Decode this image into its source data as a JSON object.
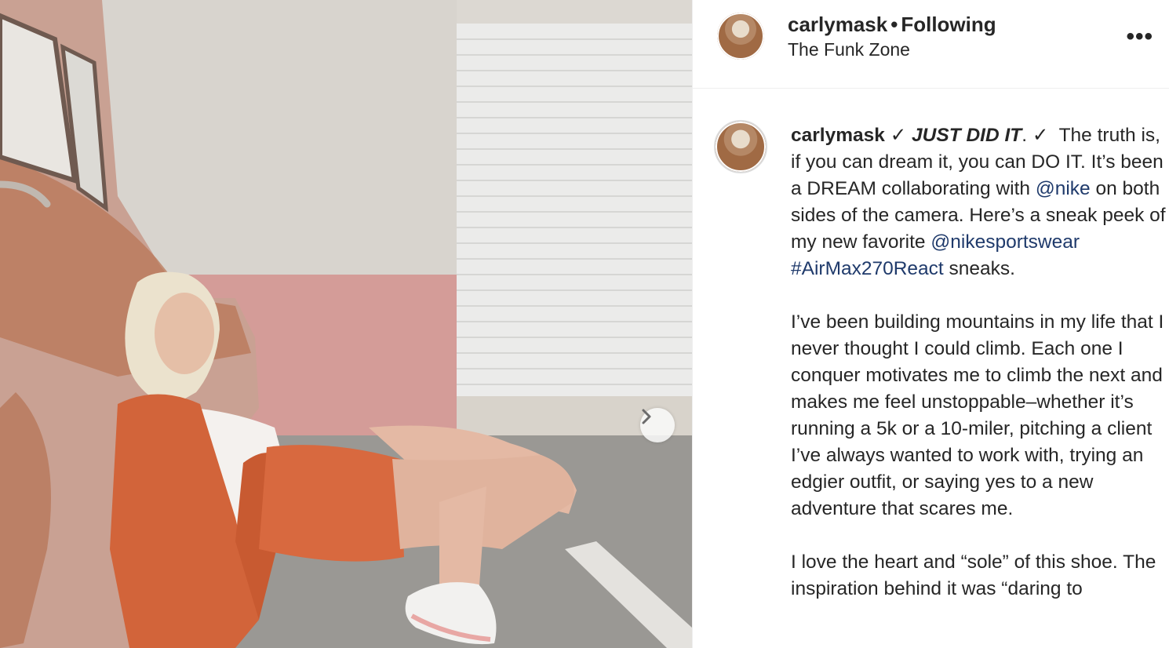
{
  "post": {
    "username": "carlymask",
    "follow_status": "Following",
    "location": "The Funk Zone",
    "more_icon": "more-options-icon"
  },
  "carousel": {
    "next_icon": "chevron-right-icon"
  },
  "caption": {
    "username": "carlymask",
    "check1": "✓",
    "headline": "JUST DID IT",
    "period": ".",
    "check2": "✓",
    "p1_a": "The truth is, if you can dream it, you can DO IT. It’s been a DREAM collaborating with",
    "mention_nike": "@nike",
    "p1_b": "on both sides of the camera. Here’s a sneak peek of my new favorite",
    "mention_nikesportswear": "@nikesportswear",
    "hashtag": "#AirMax270React",
    "p1_c": "sneaks.",
    "p2": "I’ve been building mountains in my life that I never thought I could climb. Each one I conquer motivates me to climb the next and makes me feel unstoppable–whether it’s running a 5k or a 10-miler, pitching a client I’ve always wanted to work with, trying an edgier outfit, or saying yes to a new adventure that scares me.",
    "p3": "I love the heart and “sole” of this shoe. The inspiration behind it was “daring to"
  },
  "colors": {
    "link": "#1f3a6b",
    "text": "#262626",
    "jacket": "#d2643a"
  }
}
